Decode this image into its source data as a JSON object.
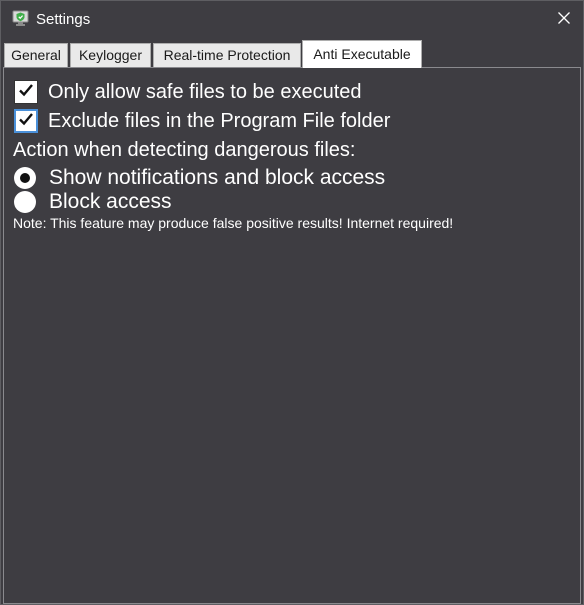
{
  "window": {
    "title": "Settings",
    "app_icon": "shield-monitor-icon",
    "close_icon": "close-icon"
  },
  "tabs": [
    {
      "label": "General",
      "active": false
    },
    {
      "label": "Keylogger",
      "active": false
    },
    {
      "label": "Real-time Protection",
      "active": false
    },
    {
      "label": "Anti Executable",
      "active": true
    }
  ],
  "anti_executable": {
    "options": [
      {
        "label": "Only allow safe files to be executed",
        "checked": true
      },
      {
        "label": "Exclude files in the Program File folder",
        "checked": true
      }
    ],
    "action_heading": "Action when detecting dangerous files:",
    "actions": [
      {
        "label": "Show notifications and block access",
        "selected": true
      },
      {
        "label": "Block access",
        "selected": false
      }
    ],
    "note": "Note: This feature may produce false positive results! Internet required!"
  },
  "colors": {
    "background": "#3e3d42",
    "text": "#ffffff",
    "accent_focus": "#4a90d9",
    "icon_green": "#3fae49"
  }
}
